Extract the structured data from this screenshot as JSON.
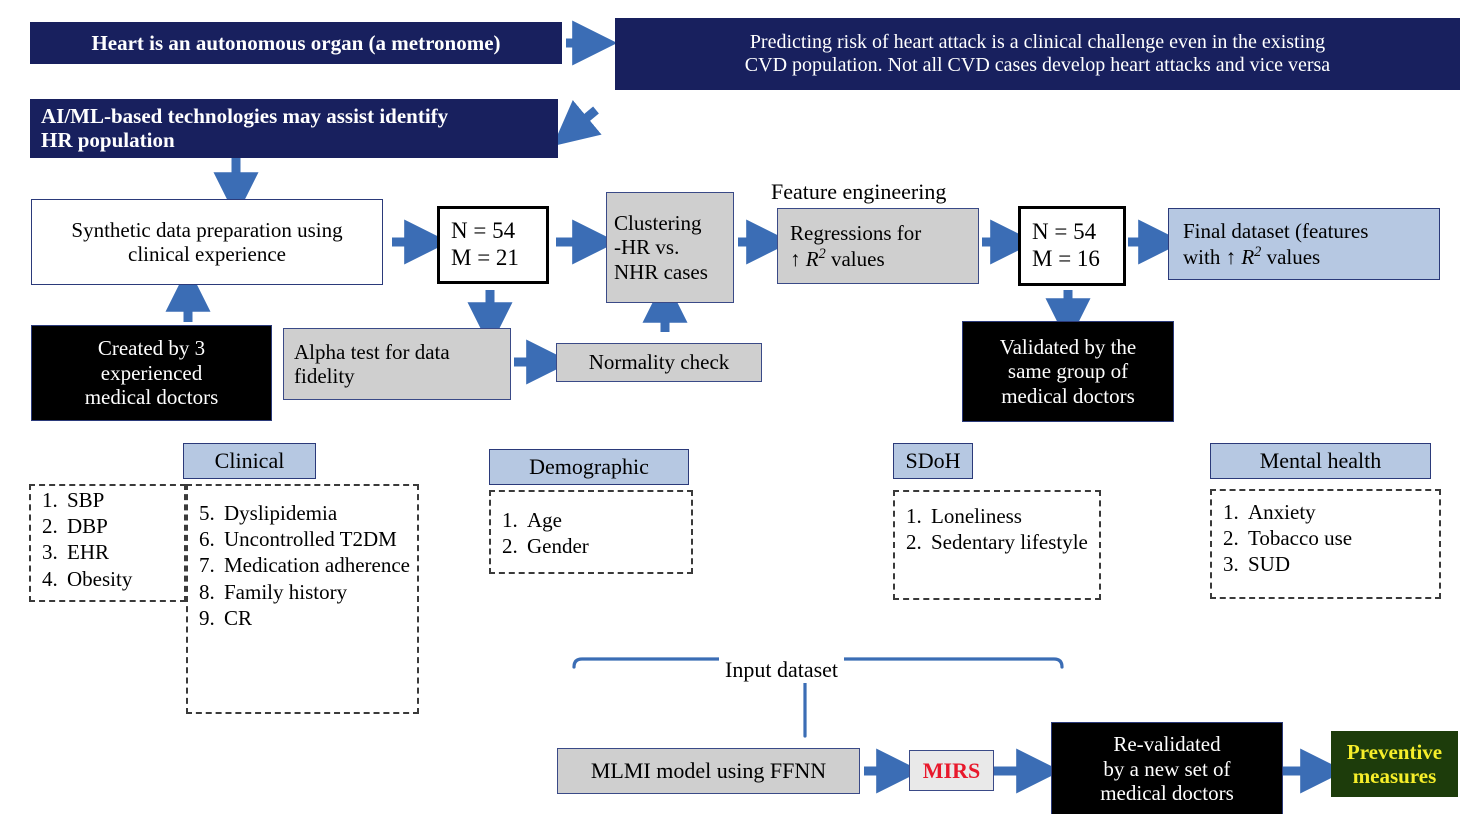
{
  "diagram": {
    "title_flow": "MLMI heart attack risk prediction pipeline",
    "colors": {
      "navy": "#18205e",
      "arrow_blue": "#3b6db5",
      "light_blue": "#b6c8e2",
      "grey": "#cfcfcf",
      "black": "#000000",
      "green": "#1d3c0b",
      "yellow": "#f6ee2a",
      "red": "#e8192c"
    }
  },
  "premise": {
    "heart": "Heart is an autonomous organ (a metronome)",
    "prediction_line1": "Predicting risk of heart attack is a clinical challenge even in the existing",
    "prediction_line2": "CVD population. Not all CVD cases develop heart attacks and vice versa",
    "aiml_line1": "AI/ML-based technologies may assist identify",
    "aiml_line2": "HR population"
  },
  "pipeline": {
    "synthetic_line1": "Synthetic data preparation using",
    "synthetic_line2": "clinical experience",
    "counts_1": {
      "n": "N = 54",
      "m": "M = 21"
    },
    "clustering_line1": "Clustering",
    "clustering_line2": "-HR vs.",
    "clustering_line3": "NHR cases",
    "feature_engineering_label": "Feature engineering",
    "regressions_line1": "Regressions for",
    "regressions_line2_prefix": "↑ ",
    "regressions_line2_var": "R",
    "regressions_line2_exp": "2",
    "regressions_line2_suffix": " values",
    "counts_2": {
      "n": "N = 54",
      "m": "M = 16"
    },
    "final_dataset_line1": "Final dataset (features",
    "final_dataset_line2_prefix": "with ↑ ",
    "final_dataset_line2_var": "R",
    "final_dataset_line2_exp": "2",
    "final_dataset_line2_suffix": " values",
    "created_by_line1": "Created by 3",
    "created_by_line2": "experienced",
    "created_by_line3": "medical doctors",
    "alpha_test_line1": "Alpha test for data",
    "alpha_test_line2": "fidelity",
    "normality_check": "Normality check",
    "validated_line1": "Validated by the",
    "validated_line2": "same group of",
    "validated_line3": "medical doctors"
  },
  "features": {
    "clinical": {
      "header": "Clinical",
      "items_left": [
        "SBP",
        "DBP",
        "EHR",
        "Obesity"
      ],
      "items_right": [
        "Dyslipidemia",
        "Uncontrolled T2DM",
        "Medication adherence",
        "Family history",
        "CR"
      ],
      "right_start_index": 5
    },
    "demographic": {
      "header": "Demographic",
      "items": [
        "Age",
        "Gender"
      ]
    },
    "sdoh": {
      "header": "SDoH",
      "items": [
        "Loneliness",
        "Sedentary lifestyle"
      ]
    },
    "mental_health": {
      "header": "Mental health",
      "items": [
        "Anxiety",
        "Tobacco use",
        "SUD"
      ]
    }
  },
  "model": {
    "input_dataset_label": "Input dataset",
    "mlmi_model": "MLMI model using FFNN",
    "mirs": "MIRS",
    "revalidated_line1": "Re-validated",
    "revalidated_line2": "by a new set of",
    "revalidated_line3": "medical doctors",
    "preventive_line1": "Preventive",
    "preventive_line2": "measures"
  }
}
